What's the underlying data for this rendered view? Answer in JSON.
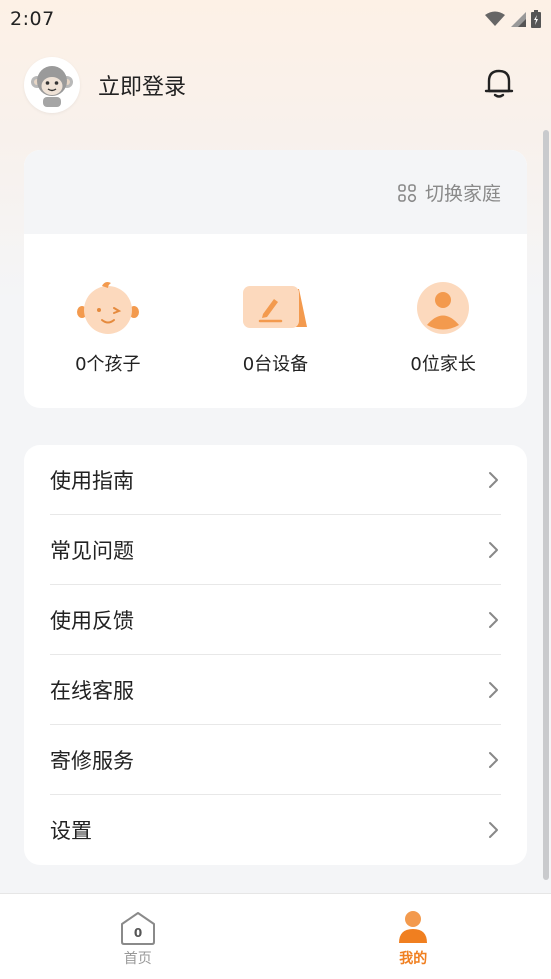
{
  "status_bar": {
    "time": "2:07",
    "icons": [
      "wifi-icon",
      "signal-icon",
      "battery-icon"
    ]
  },
  "profile": {
    "login_label": "立即登录",
    "avatar_icon": "monkey-avatar-icon",
    "bell_icon": "bell-icon"
  },
  "family": {
    "switch_label": "切换家庭",
    "switch_icon": "switch-family-icon",
    "stats": [
      {
        "label": "0个孩子",
        "icon": "baby-face-icon"
      },
      {
        "label": "0台设备",
        "icon": "device-icon"
      },
      {
        "label": "0位家长",
        "icon": "parent-icon"
      }
    ]
  },
  "menu": {
    "items": [
      {
        "label": "使用指南"
      },
      {
        "label": "常见问题"
      },
      {
        "label": "使用反馈"
      },
      {
        "label": "在线客服"
      },
      {
        "label": "寄修服务"
      },
      {
        "label": "设置"
      }
    ]
  },
  "tabs": {
    "home_label": "首页",
    "home_badge": "0",
    "me_label": "我的",
    "active": "me"
  },
  "colors": {
    "accent": "#f07f20",
    "icon_orange": "#f5a15c",
    "text": "#222222",
    "muted": "#8a8a8a",
    "background": "#f4f5f7"
  }
}
